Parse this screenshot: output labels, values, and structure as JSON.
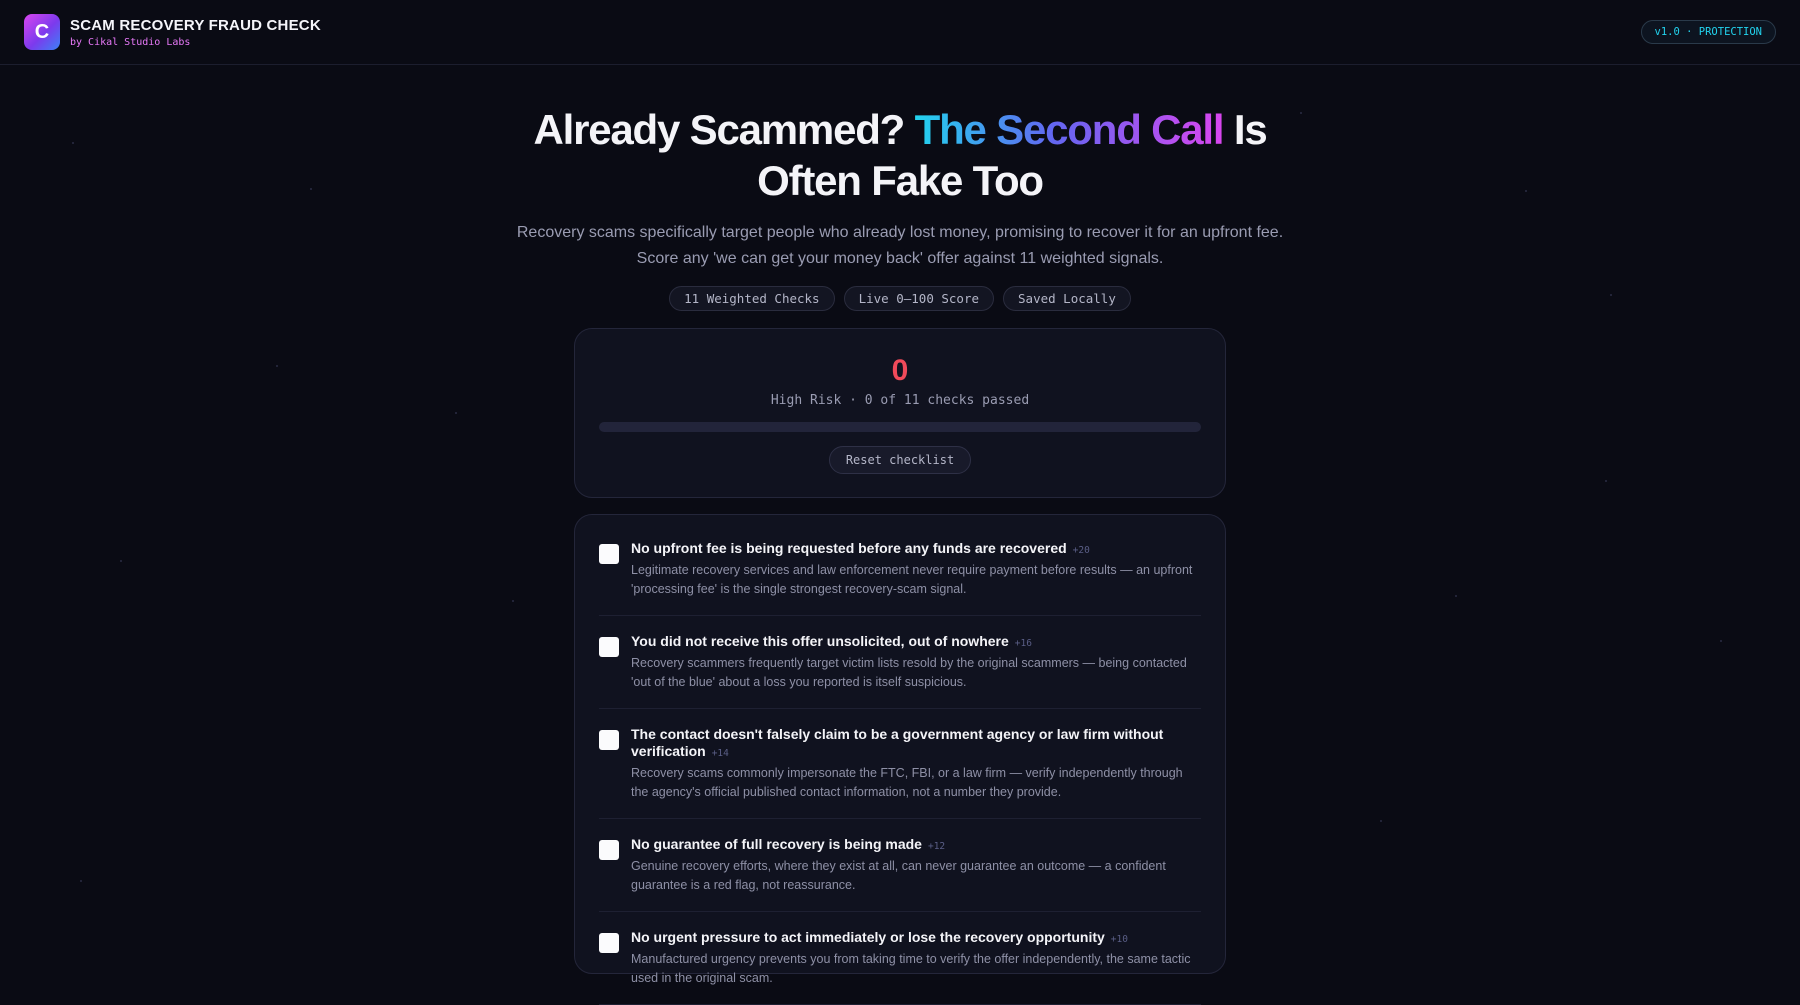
{
  "header": {
    "logo_letter": "C",
    "title": "SCAM RECOVERY FRAUD CHECK",
    "subtitle": "by Cikal Studio Labs",
    "version_badge": "v1.0 · PROTECTION"
  },
  "hero": {
    "title_part1": "Already Scammed?",
    "title_highlight": "The Second Call",
    "title_part2": "Is",
    "title_line2": "Often Fake Too",
    "subtitle_line1": "Recovery scams specifically target people who already lost money, promising to recover it for an upfront fee.",
    "subtitle_line2": "Score any 'we can get your money back' offer against 11 weighted signals.",
    "pills": [
      "11 Weighted Checks",
      "Live 0–100 Score",
      "Saved Locally"
    ]
  },
  "score": {
    "value": "0",
    "status": "High Risk · 0 of 11 checks passed",
    "progress_fraction": 0,
    "reset_label": "Reset checklist"
  },
  "checks": [
    {
      "title": "No upfront fee is being requested before any funds are recovered",
      "weight": "+20",
      "description": "Legitimate recovery services and law enforcement never require payment before results — an upfront 'processing fee' is the single strongest recovery-scam signal.",
      "checked": false
    },
    {
      "title": "You did not receive this offer unsolicited, out of nowhere",
      "weight": "+16",
      "description": "Recovery scammers frequently target victim lists resold by the original scammers — being contacted 'out of the blue' about a loss you reported is itself suspicious.",
      "checked": false
    },
    {
      "title": "The contact doesn't falsely claim to be a government agency or law firm without verification",
      "weight": "+14",
      "description": "Recovery scams commonly impersonate the FTC, FBI, or a law firm — verify independently through the agency's official published contact information, not a number they provide.",
      "checked": false
    },
    {
      "title": "No guarantee of full recovery is being made",
      "weight": "+12",
      "description": "Genuine recovery efforts, where they exist at all, can never guarantee an outcome — a confident guarantee is a red flag, not reassurance.",
      "checked": false
    },
    {
      "title": "No urgent pressure to act immediately or lose the recovery opportunity",
      "weight": "+10",
      "description": "Manufactured urgency prevents you from taking time to verify the offer independently, the same tactic used in the original scam.",
      "checked": false
    }
  ],
  "colors": {
    "background": "#0a0b14",
    "risk": "#f04a5a",
    "accent_cyan": "#22d3ee",
    "accent_magenta": "#d946ef"
  }
}
